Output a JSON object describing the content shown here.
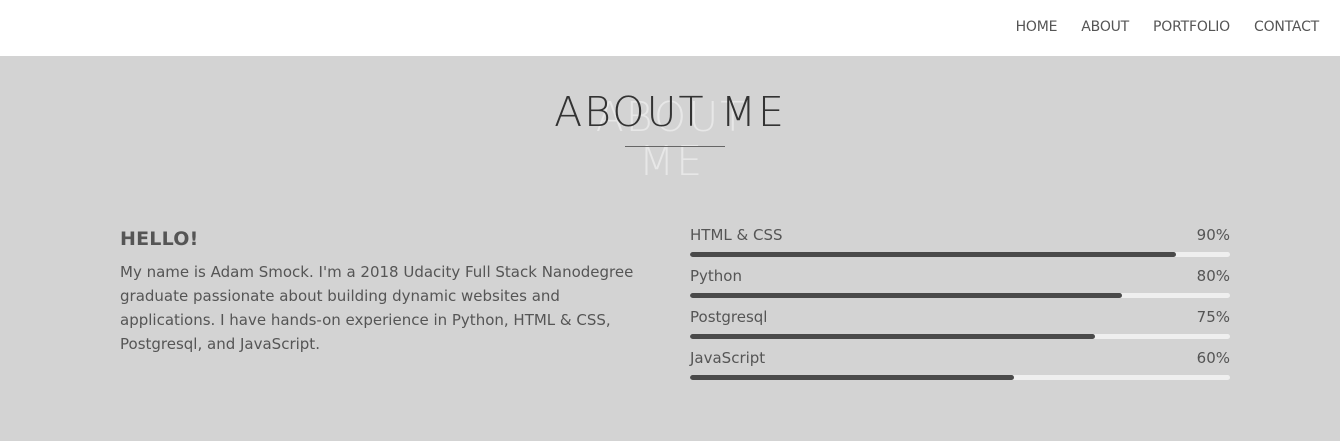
{
  "nav": {
    "items": [
      "HOME",
      "ABOUT",
      "PORTFOLIO",
      "CONTACT"
    ]
  },
  "about": {
    "title": "ABOUT ME",
    "greeting": "HELLO!",
    "bio": "My name is Adam Smock. I'm a 2018 Udacity Full Stack Nanodegree graduate passionate about building dynamic websites and applications. I have hands-on experience in Python, HTML & CSS, Postgresql, and JavaScript."
  },
  "skills": [
    {
      "label": "HTML & CSS",
      "percent_text": "90%",
      "level": 0.9
    },
    {
      "label": "Python",
      "percent_text": "80%",
      "level": 0.8
    },
    {
      "label": "Postgresql",
      "percent_text": "75%",
      "level": 0.75
    },
    {
      "label": "JavaScript",
      "percent_text": "60%",
      "level": 0.6
    }
  ],
  "colors": {
    "background": "#d3d3d3",
    "navbar": "#ffffff",
    "bar_fill": "#4a4a4a",
    "bar_track": "#efefef"
  }
}
